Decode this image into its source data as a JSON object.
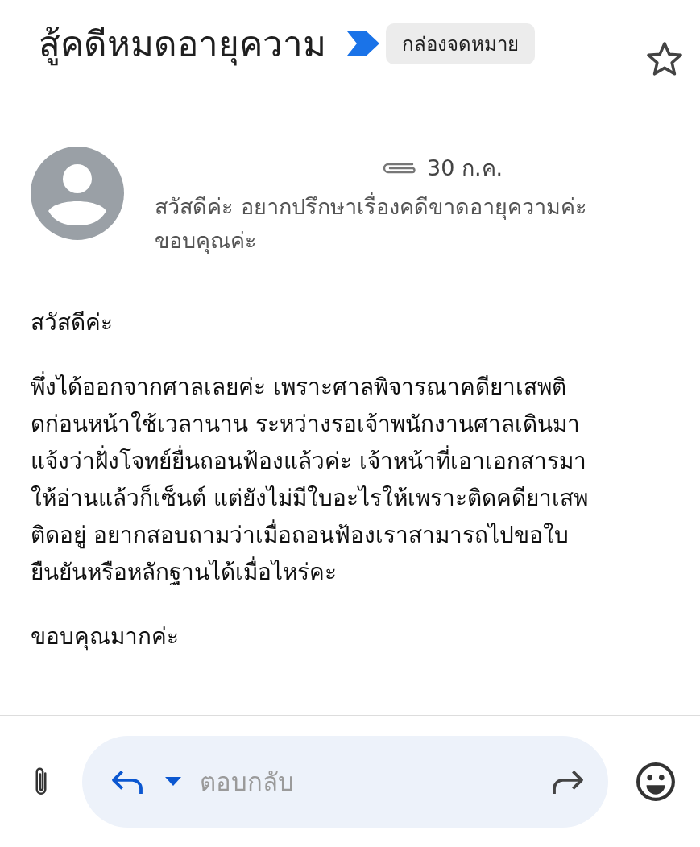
{
  "subject": "สู้คดีหมดอายุความ",
  "label": "กล่องจดหมาย",
  "important": true,
  "starred": false,
  "message": {
    "has_attachment": true,
    "date": "30 ก.ค.",
    "snippet": "สวัสดีค่ะ อยากปรึกษาเรื่องคดีขาดอายุความค่ะ ขอบคุณค่ะ"
  },
  "body": [
    {
      "lines": [
        "สวัสดีค่ะ"
      ]
    },
    {
      "lines": [
        "พึ่งได้ออกจากศาลเลยค่ะ เพราะศาลพิจารณาคดียาเสพติ",
        "ดก่อนหน้าใช้เวลานาน ระหว่างรอเจ้าพนักงานศาลเดินมา",
        "แจ้งว่าฝั่งโจทย์ยื่นถอนฟ้องแล้วค่ะ เจ้าหน้าที่เอาเอกสารมา",
        "ให้อ่านแล้วก็เซ็นต์ แต่ยังไม่มีใบอะไรให้เพราะติดคดียาเสพ",
        "ติดอยู่ อยากสอบถามว่าเมื่อถอนฟ้องเราสามารถไปขอใบ",
        "ยืนยันหรือหลักฐานได้เมื่อไหร่คะ"
      ]
    },
    {
      "lines": [
        "ขอบคุณมากค่ะ"
      ]
    }
  ],
  "reply_bar": {
    "placeholder": "ตอบกลับ"
  }
}
